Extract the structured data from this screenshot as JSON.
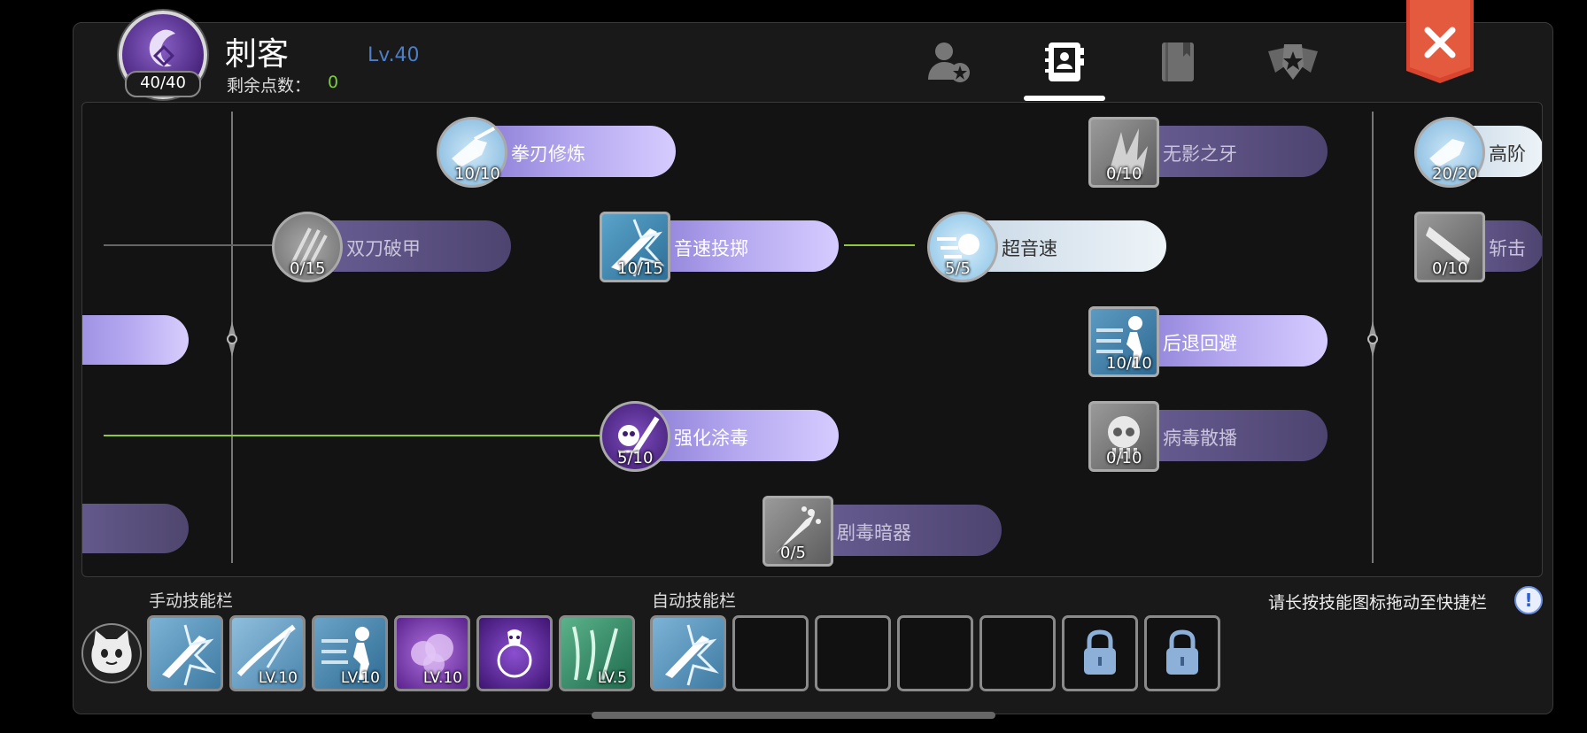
{
  "header": {
    "class_name": "刺客",
    "class_points": "40/40",
    "level": "Lv.40",
    "remaining_label": "剩余点数：",
    "remaining_value": "0"
  },
  "tabs": [
    {
      "name": "character-tab",
      "icon": "person-star-icon",
      "active": false
    },
    {
      "name": "skill-tab",
      "icon": "contact-book-icon",
      "active": true
    },
    {
      "name": "book-tab",
      "icon": "book-icon",
      "active": false
    },
    {
      "name": "emblem-tab",
      "icon": "winged-shield-icon",
      "active": false
    }
  ],
  "skills": {
    "quan_ren": {
      "name": "拳刃修炼",
      "level": "10/10",
      "state": "active"
    },
    "shuang_dao": {
      "name": "双刀破甲",
      "level": "0/15",
      "state": "inactive"
    },
    "yin_su": {
      "name": "音速投掷",
      "level": "10/15",
      "state": "active"
    },
    "chao_yin_su": {
      "name": "超音速",
      "level": "5/5",
      "state": "max"
    },
    "wu_ying": {
      "name": "无影之牙",
      "level": "0/10",
      "state": "inactive"
    },
    "hou_tui": {
      "name": "后退回避",
      "level": "10/10",
      "state": "active"
    },
    "qiang_hua": {
      "name": "强化涂毒",
      "level": "5/10",
      "state": "active"
    },
    "bing_du": {
      "name": "病毒散播",
      "level": "0/10",
      "state": "inactive"
    },
    "ju_du": {
      "name": "剧毒暗器",
      "level": "0/5",
      "state": "inactive"
    },
    "gao_jie": {
      "name": "高阶",
      "level": "20/20",
      "state": "max"
    },
    "zhan_ji": {
      "name": "斩击",
      "level": "0/10",
      "state": "inactive"
    }
  },
  "bottom": {
    "manual_label": "手动技能栏",
    "auto_label": "自动技能栏",
    "hint": "请长按技能图标拖动至快捷栏",
    "manual_slots": [
      {
        "icon": "sword-burst-icon",
        "level": ""
      },
      {
        "icon": "blade-slash-icon",
        "level": "LV.10"
      },
      {
        "icon": "dash-back-icon",
        "level": "LV.10"
      },
      {
        "icon": "purple-smoke-icon",
        "level": "LV.10"
      },
      {
        "icon": "poison-flask-icon",
        "level": ""
      },
      {
        "icon": "green-wind-icon",
        "level": "LV.5"
      }
    ],
    "auto_slots": [
      {
        "icon": "sword-burst-icon",
        "state": "filled"
      },
      {
        "icon": "",
        "state": "empty"
      },
      {
        "icon": "",
        "state": "empty"
      },
      {
        "icon": "",
        "state": "empty"
      },
      {
        "icon": "",
        "state": "empty"
      },
      {
        "icon": "lock-icon",
        "state": "locked"
      },
      {
        "icon": "lock-icon",
        "state": "locked"
      }
    ]
  },
  "colors": {
    "level": "#4d7fc8",
    "remaining": "#7ccf3c",
    "link_green": "#8fc93a",
    "close_red": "#d8442e"
  }
}
